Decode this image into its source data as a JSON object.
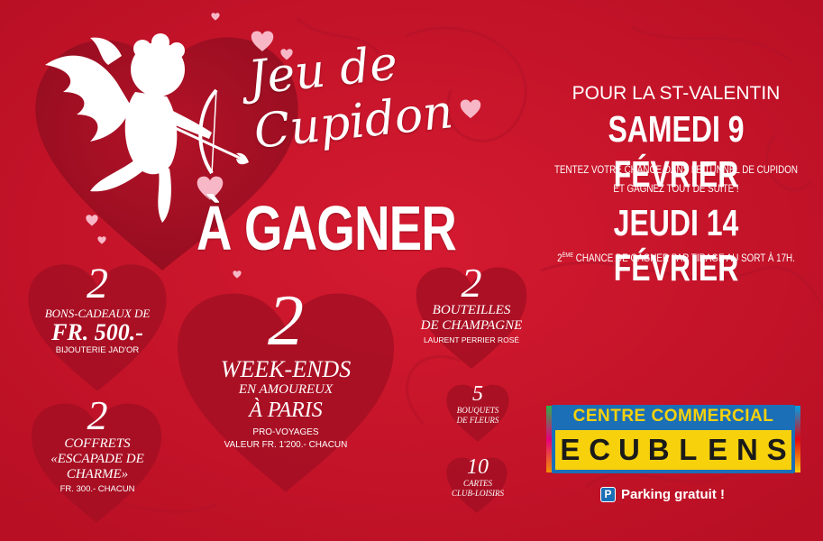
{
  "colors": {
    "background": "#c8142a",
    "heart_dark": "#9c0f22",
    "pink": "#f7b7c6",
    "logo_blue": "#1b6fb6",
    "logo_yellow": "#f6d10c"
  },
  "title": {
    "script": "Jeu de Cupidon",
    "a_gagner": "À GAGNER"
  },
  "event": {
    "intro": "POUR LA ST-VALENTIN",
    "date1": "SAMEDI 9 FÉVRIER",
    "line1": "TENTEZ VOTRE CHANCE DANS LE TUNNEL DE CUPIDON",
    "line2": "ET GAGNEZ TOUT DE SUITE !",
    "date2": "JEUDI 14 FÉVRIER",
    "chance_prefix": "2",
    "chance_sup": "ÈME",
    "chance_text": " CHANCE DE GAGNER PAR TIRAGE AU SORT À 17H."
  },
  "prizes": {
    "bons": {
      "count": "2",
      "line1": "BONS-CADEAUX DE",
      "line2": "FR. 500.-",
      "sub": "BIJOUTERIE JAD'OR"
    },
    "coffrets": {
      "count": "2",
      "line1": "COFFRETS",
      "line2": "«ESCAPADE DE",
      "line3": "CHARME»",
      "sub": "FR. 300.- CHACUN"
    },
    "weekends": {
      "count": "2",
      "line1": "WEEK-ENDS",
      "line2": "EN AMOUREUX",
      "line3": "À PARIS",
      "sub1": "PRO-VOYAGES",
      "sub2": "VALEUR FR. 1'200.- CHACUN"
    },
    "bouteilles": {
      "count": "2",
      "line1": "BOUTEILLES",
      "line2": "DE CHAMPAGNE",
      "sub": "LAURENT PERRIER ROSÉ"
    },
    "bouquets": {
      "count": "5",
      "line1": "BOUQUETS",
      "line2": "DE FLEURS"
    },
    "cartes": {
      "count": "10",
      "line1": "CARTES",
      "line2": "CLUB-LOISIRS"
    }
  },
  "logo": {
    "line1": "CENTRE COMMERCIAL",
    "letters": [
      "E",
      "C",
      "U",
      "B",
      "L",
      "E",
      "N",
      "S"
    ],
    "parking_icon": "P",
    "parking": "Parking gratuit !"
  },
  "icons": [
    "cupid-icon",
    "heart-icon",
    "parking-icon"
  ]
}
